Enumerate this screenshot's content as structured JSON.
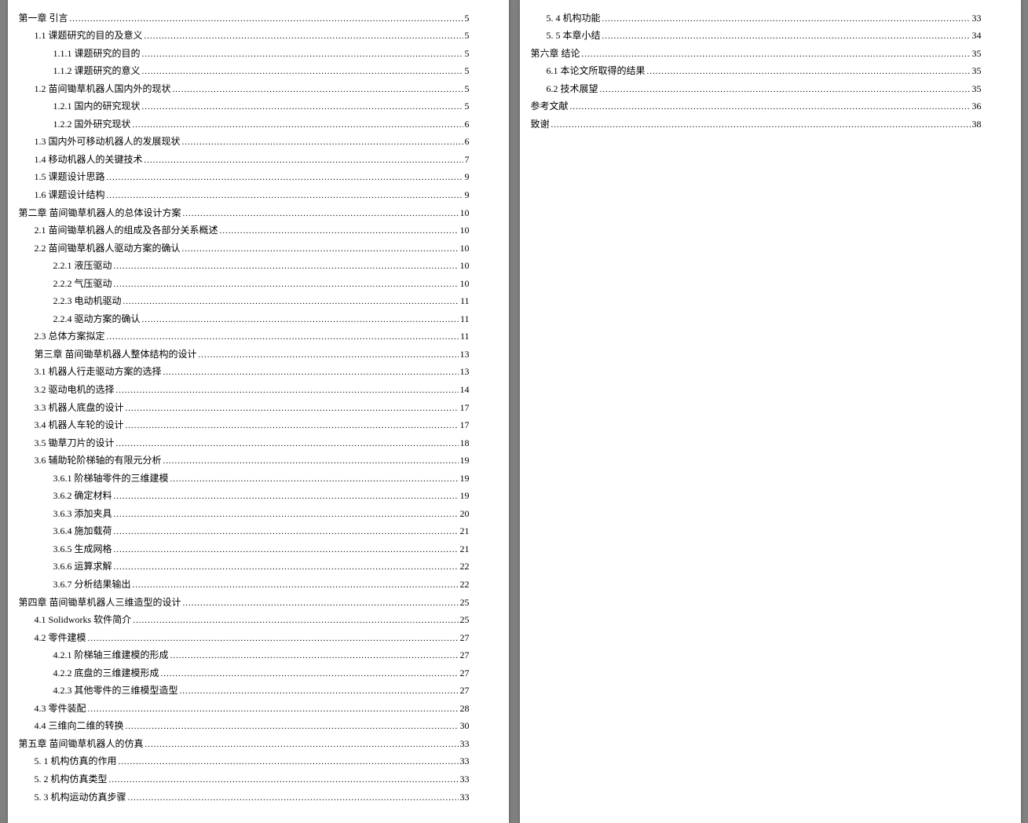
{
  "pages": [
    {
      "entries": [
        {
          "level": 0,
          "title": "第一章 引言",
          "page": "5"
        },
        {
          "level": 1,
          "title": "1.1 课题研究的目的及意义",
          "page": "5"
        },
        {
          "level": 2,
          "title": "1.1.1 课题研究的目的",
          "page": "5"
        },
        {
          "level": 2,
          "title": "1.1.2 课题研究的意义",
          "page": "5"
        },
        {
          "level": 1,
          "title": "1.2 苗间锄草机器人国内外的现状",
          "page": "5"
        },
        {
          "level": 2,
          "title": "1.2.1 国内的研究现状",
          "page": "5"
        },
        {
          "level": 2,
          "title": "1.2.2 国外研究现状",
          "page": "6"
        },
        {
          "level": 1,
          "title": "1.3 国内外可移动机器人的发展现状",
          "page": "6"
        },
        {
          "level": 1,
          "title": "1.4 移动机器人的关键技术",
          "page": "7"
        },
        {
          "level": 1,
          "title": "1.5 课题设计思路",
          "page": "9"
        },
        {
          "level": 1,
          "title": "1.6 课题设计结构",
          "page": "9"
        },
        {
          "level": 0,
          "title": "第二章 苗间锄草机器人的总体设计方案",
          "page": "10"
        },
        {
          "level": 1,
          "title": "2.1 苗间锄草机器人的组成及各部分关系概述",
          "page": "10"
        },
        {
          "level": 1,
          "title": "2.2 苗间锄草机器人驱动方案的确认",
          "page": "10"
        },
        {
          "level": 2,
          "title": "2.2.1 液压驱动",
          "page": "10"
        },
        {
          "level": 2,
          "title": "2.2.2  气压驱动",
          "page": "10"
        },
        {
          "level": 2,
          "title": "2.2.3  电动机驱动",
          "page": "11"
        },
        {
          "level": 2,
          "title": "2.2.4  驱动方案的确认",
          "page": "11"
        },
        {
          "level": 1,
          "title": "2.3 总体方案拟定",
          "page": "11"
        },
        {
          "level": 1,
          "title": "第三章 苗间锄草机器人整体结构的设计",
          "page": "13"
        },
        {
          "level": 1,
          "title": "3.1 机器人行走驱动方案的选择",
          "page": "13"
        },
        {
          "level": 1,
          "title": "3.2 驱动电机的选择",
          "page": "14"
        },
        {
          "level": 1,
          "title": "3.3 机器人底盘的设计",
          "page": "17"
        },
        {
          "level": 1,
          "title": "3.4 机器人车轮的设计",
          "page": "17"
        },
        {
          "level": 1,
          "title": "3.5 锄草刀片的设计",
          "page": "18"
        },
        {
          "level": 1,
          "title": "3.6 辅助轮阶梯轴的有限元分析",
          "page": "19"
        },
        {
          "level": 2,
          "title": "3.6.1 阶梯轴零件的三维建模",
          "page": "19"
        },
        {
          "level": 2,
          "title": "3.6.2 确定材料",
          "page": "19"
        },
        {
          "level": 2,
          "title": "3.6.3 添加夹具",
          "page": "20"
        },
        {
          "level": 2,
          "title": "3.6.4 施加载荷",
          "page": "21"
        },
        {
          "level": 2,
          "title": "3.6.5 生成网格",
          "page": "21"
        },
        {
          "level": 2,
          "title": "3.6.6 运算求解",
          "page": "22"
        },
        {
          "level": 2,
          "title": "3.6.7 分析结果输出",
          "page": "22"
        },
        {
          "level": 0,
          "title": "第四章 苗间锄草机器人三维造型的设计",
          "page": "25"
        },
        {
          "level": 1,
          "title": "4.1 Solidworks 软件简介",
          "page": "25"
        },
        {
          "level": 1,
          "title": "4.2 零件建模",
          "page": "27"
        },
        {
          "level": 2,
          "title": "4.2.1 阶梯轴三维建模的形成",
          "page": "27"
        },
        {
          "level": 2,
          "title": "4.2.2 底盘的三维建模形成",
          "page": "27"
        },
        {
          "level": 2,
          "title": "4.2.3 其他零件的三维模型造型",
          "page": "27"
        },
        {
          "level": 1,
          "title": "4.3 零件装配",
          "page": "28"
        },
        {
          "level": 1,
          "title": "4.4 三维向二维的转换",
          "page": "30"
        },
        {
          "level": 0,
          "title": "第五章  苗间锄草机器人的仿真",
          "page": "33"
        },
        {
          "level": 1,
          "title": "5. 1 机构仿真的作用",
          "page": "33"
        },
        {
          "level": 1,
          "title": "5. 2 机构仿真类型",
          "page": "33"
        },
        {
          "level": 1,
          "title": "5. 3 机构运动仿真步骤",
          "page": "33"
        }
      ]
    },
    {
      "entries": [
        {
          "level": 1,
          "title": "5. 4  机构功能",
          "page": "33"
        },
        {
          "level": 1,
          "title": "5. 5  本章小结",
          "page": "34"
        },
        {
          "level": 0,
          "title": "第六章 结论",
          "page": "35"
        },
        {
          "level": 1,
          "title": "6.1 本论文所取得的结果",
          "page": "35"
        },
        {
          "level": 1,
          "title": "6.2 技术展望",
          "page": "35"
        },
        {
          "level": 0,
          "title": "参考文献",
          "page": "36"
        },
        {
          "level": 0,
          "title": "致谢",
          "page": "38"
        }
      ]
    }
  ]
}
